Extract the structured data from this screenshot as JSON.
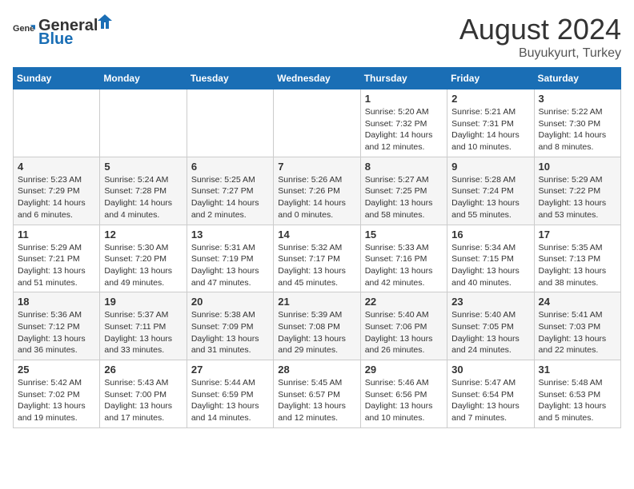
{
  "header": {
    "logo_general": "General",
    "logo_blue": "Blue",
    "month_year": "August 2024",
    "location": "Buyukyurt, Turkey"
  },
  "days_of_week": [
    "Sunday",
    "Monday",
    "Tuesday",
    "Wednesday",
    "Thursday",
    "Friday",
    "Saturday"
  ],
  "weeks": [
    [
      {
        "day": "",
        "info": ""
      },
      {
        "day": "",
        "info": ""
      },
      {
        "day": "",
        "info": ""
      },
      {
        "day": "",
        "info": ""
      },
      {
        "day": "1",
        "info": "Sunrise: 5:20 AM\nSunset: 7:32 PM\nDaylight: 14 hours\nand 12 minutes."
      },
      {
        "day": "2",
        "info": "Sunrise: 5:21 AM\nSunset: 7:31 PM\nDaylight: 14 hours\nand 10 minutes."
      },
      {
        "day": "3",
        "info": "Sunrise: 5:22 AM\nSunset: 7:30 PM\nDaylight: 14 hours\nand 8 minutes."
      }
    ],
    [
      {
        "day": "4",
        "info": "Sunrise: 5:23 AM\nSunset: 7:29 PM\nDaylight: 14 hours\nand 6 minutes."
      },
      {
        "day": "5",
        "info": "Sunrise: 5:24 AM\nSunset: 7:28 PM\nDaylight: 14 hours\nand 4 minutes."
      },
      {
        "day": "6",
        "info": "Sunrise: 5:25 AM\nSunset: 7:27 PM\nDaylight: 14 hours\nand 2 minutes."
      },
      {
        "day": "7",
        "info": "Sunrise: 5:26 AM\nSunset: 7:26 PM\nDaylight: 14 hours\nand 0 minutes."
      },
      {
        "day": "8",
        "info": "Sunrise: 5:27 AM\nSunset: 7:25 PM\nDaylight: 13 hours\nand 58 minutes."
      },
      {
        "day": "9",
        "info": "Sunrise: 5:28 AM\nSunset: 7:24 PM\nDaylight: 13 hours\nand 55 minutes."
      },
      {
        "day": "10",
        "info": "Sunrise: 5:29 AM\nSunset: 7:22 PM\nDaylight: 13 hours\nand 53 minutes."
      }
    ],
    [
      {
        "day": "11",
        "info": "Sunrise: 5:29 AM\nSunset: 7:21 PM\nDaylight: 13 hours\nand 51 minutes."
      },
      {
        "day": "12",
        "info": "Sunrise: 5:30 AM\nSunset: 7:20 PM\nDaylight: 13 hours\nand 49 minutes."
      },
      {
        "day": "13",
        "info": "Sunrise: 5:31 AM\nSunset: 7:19 PM\nDaylight: 13 hours\nand 47 minutes."
      },
      {
        "day": "14",
        "info": "Sunrise: 5:32 AM\nSunset: 7:17 PM\nDaylight: 13 hours\nand 45 minutes."
      },
      {
        "day": "15",
        "info": "Sunrise: 5:33 AM\nSunset: 7:16 PM\nDaylight: 13 hours\nand 42 minutes."
      },
      {
        "day": "16",
        "info": "Sunrise: 5:34 AM\nSunset: 7:15 PM\nDaylight: 13 hours\nand 40 minutes."
      },
      {
        "day": "17",
        "info": "Sunrise: 5:35 AM\nSunset: 7:13 PM\nDaylight: 13 hours\nand 38 minutes."
      }
    ],
    [
      {
        "day": "18",
        "info": "Sunrise: 5:36 AM\nSunset: 7:12 PM\nDaylight: 13 hours\nand 36 minutes."
      },
      {
        "day": "19",
        "info": "Sunrise: 5:37 AM\nSunset: 7:11 PM\nDaylight: 13 hours\nand 33 minutes."
      },
      {
        "day": "20",
        "info": "Sunrise: 5:38 AM\nSunset: 7:09 PM\nDaylight: 13 hours\nand 31 minutes."
      },
      {
        "day": "21",
        "info": "Sunrise: 5:39 AM\nSunset: 7:08 PM\nDaylight: 13 hours\nand 29 minutes."
      },
      {
        "day": "22",
        "info": "Sunrise: 5:40 AM\nSunset: 7:06 PM\nDaylight: 13 hours\nand 26 minutes."
      },
      {
        "day": "23",
        "info": "Sunrise: 5:40 AM\nSunset: 7:05 PM\nDaylight: 13 hours\nand 24 minutes."
      },
      {
        "day": "24",
        "info": "Sunrise: 5:41 AM\nSunset: 7:03 PM\nDaylight: 13 hours\nand 22 minutes."
      }
    ],
    [
      {
        "day": "25",
        "info": "Sunrise: 5:42 AM\nSunset: 7:02 PM\nDaylight: 13 hours\nand 19 minutes."
      },
      {
        "day": "26",
        "info": "Sunrise: 5:43 AM\nSunset: 7:00 PM\nDaylight: 13 hours\nand 17 minutes."
      },
      {
        "day": "27",
        "info": "Sunrise: 5:44 AM\nSunset: 6:59 PM\nDaylight: 13 hours\nand 14 minutes."
      },
      {
        "day": "28",
        "info": "Sunrise: 5:45 AM\nSunset: 6:57 PM\nDaylight: 13 hours\nand 12 minutes."
      },
      {
        "day": "29",
        "info": "Sunrise: 5:46 AM\nSunset: 6:56 PM\nDaylight: 13 hours\nand 10 minutes."
      },
      {
        "day": "30",
        "info": "Sunrise: 5:47 AM\nSunset: 6:54 PM\nDaylight: 13 hours\nand 7 minutes."
      },
      {
        "day": "31",
        "info": "Sunrise: 5:48 AM\nSunset: 6:53 PM\nDaylight: 13 hours\nand 5 minutes."
      }
    ]
  ]
}
